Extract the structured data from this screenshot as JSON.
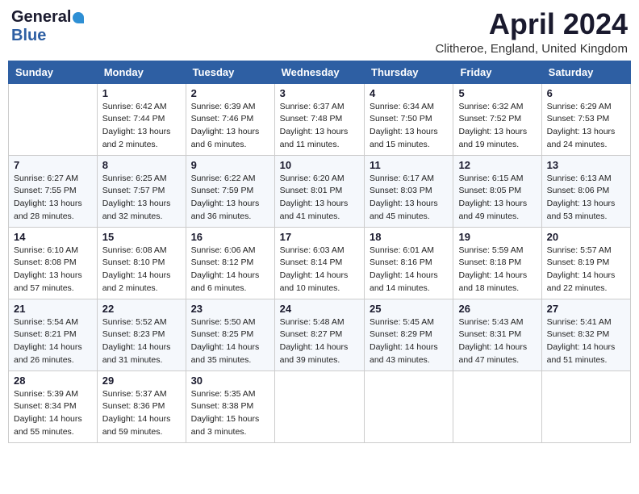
{
  "logo": {
    "general": "General",
    "blue": "Blue"
  },
  "title": "April 2024",
  "location": "Clitheroe, England, United Kingdom",
  "days_of_week": [
    "Sunday",
    "Monday",
    "Tuesday",
    "Wednesday",
    "Thursday",
    "Friday",
    "Saturday"
  ],
  "weeks": [
    [
      {
        "day": "",
        "sunrise": "",
        "sunset": "",
        "daylight": ""
      },
      {
        "day": "1",
        "sunrise": "Sunrise: 6:42 AM",
        "sunset": "Sunset: 7:44 PM",
        "daylight": "Daylight: 13 hours and 2 minutes."
      },
      {
        "day": "2",
        "sunrise": "Sunrise: 6:39 AM",
        "sunset": "Sunset: 7:46 PM",
        "daylight": "Daylight: 13 hours and 6 minutes."
      },
      {
        "day": "3",
        "sunrise": "Sunrise: 6:37 AM",
        "sunset": "Sunset: 7:48 PM",
        "daylight": "Daylight: 13 hours and 11 minutes."
      },
      {
        "day": "4",
        "sunrise": "Sunrise: 6:34 AM",
        "sunset": "Sunset: 7:50 PM",
        "daylight": "Daylight: 13 hours and 15 minutes."
      },
      {
        "day": "5",
        "sunrise": "Sunrise: 6:32 AM",
        "sunset": "Sunset: 7:52 PM",
        "daylight": "Daylight: 13 hours and 19 minutes."
      },
      {
        "day": "6",
        "sunrise": "Sunrise: 6:29 AM",
        "sunset": "Sunset: 7:53 PM",
        "daylight": "Daylight: 13 hours and 24 minutes."
      }
    ],
    [
      {
        "day": "7",
        "sunrise": "Sunrise: 6:27 AM",
        "sunset": "Sunset: 7:55 PM",
        "daylight": "Daylight: 13 hours and 28 minutes."
      },
      {
        "day": "8",
        "sunrise": "Sunrise: 6:25 AM",
        "sunset": "Sunset: 7:57 PM",
        "daylight": "Daylight: 13 hours and 32 minutes."
      },
      {
        "day": "9",
        "sunrise": "Sunrise: 6:22 AM",
        "sunset": "Sunset: 7:59 PM",
        "daylight": "Daylight: 13 hours and 36 minutes."
      },
      {
        "day": "10",
        "sunrise": "Sunrise: 6:20 AM",
        "sunset": "Sunset: 8:01 PM",
        "daylight": "Daylight: 13 hours and 41 minutes."
      },
      {
        "day": "11",
        "sunrise": "Sunrise: 6:17 AM",
        "sunset": "Sunset: 8:03 PM",
        "daylight": "Daylight: 13 hours and 45 minutes."
      },
      {
        "day": "12",
        "sunrise": "Sunrise: 6:15 AM",
        "sunset": "Sunset: 8:05 PM",
        "daylight": "Daylight: 13 hours and 49 minutes."
      },
      {
        "day": "13",
        "sunrise": "Sunrise: 6:13 AM",
        "sunset": "Sunset: 8:06 PM",
        "daylight": "Daylight: 13 hours and 53 minutes."
      }
    ],
    [
      {
        "day": "14",
        "sunrise": "Sunrise: 6:10 AM",
        "sunset": "Sunset: 8:08 PM",
        "daylight": "Daylight: 13 hours and 57 minutes."
      },
      {
        "day": "15",
        "sunrise": "Sunrise: 6:08 AM",
        "sunset": "Sunset: 8:10 PM",
        "daylight": "Daylight: 14 hours and 2 minutes."
      },
      {
        "day": "16",
        "sunrise": "Sunrise: 6:06 AM",
        "sunset": "Sunset: 8:12 PM",
        "daylight": "Daylight: 14 hours and 6 minutes."
      },
      {
        "day": "17",
        "sunrise": "Sunrise: 6:03 AM",
        "sunset": "Sunset: 8:14 PM",
        "daylight": "Daylight: 14 hours and 10 minutes."
      },
      {
        "day": "18",
        "sunrise": "Sunrise: 6:01 AM",
        "sunset": "Sunset: 8:16 PM",
        "daylight": "Daylight: 14 hours and 14 minutes."
      },
      {
        "day": "19",
        "sunrise": "Sunrise: 5:59 AM",
        "sunset": "Sunset: 8:18 PM",
        "daylight": "Daylight: 14 hours and 18 minutes."
      },
      {
        "day": "20",
        "sunrise": "Sunrise: 5:57 AM",
        "sunset": "Sunset: 8:19 PM",
        "daylight": "Daylight: 14 hours and 22 minutes."
      }
    ],
    [
      {
        "day": "21",
        "sunrise": "Sunrise: 5:54 AM",
        "sunset": "Sunset: 8:21 PM",
        "daylight": "Daylight: 14 hours and 26 minutes."
      },
      {
        "day": "22",
        "sunrise": "Sunrise: 5:52 AM",
        "sunset": "Sunset: 8:23 PM",
        "daylight": "Daylight: 14 hours and 31 minutes."
      },
      {
        "day": "23",
        "sunrise": "Sunrise: 5:50 AM",
        "sunset": "Sunset: 8:25 PM",
        "daylight": "Daylight: 14 hours and 35 minutes."
      },
      {
        "day": "24",
        "sunrise": "Sunrise: 5:48 AM",
        "sunset": "Sunset: 8:27 PM",
        "daylight": "Daylight: 14 hours and 39 minutes."
      },
      {
        "day": "25",
        "sunrise": "Sunrise: 5:45 AM",
        "sunset": "Sunset: 8:29 PM",
        "daylight": "Daylight: 14 hours and 43 minutes."
      },
      {
        "day": "26",
        "sunrise": "Sunrise: 5:43 AM",
        "sunset": "Sunset: 8:31 PM",
        "daylight": "Daylight: 14 hours and 47 minutes."
      },
      {
        "day": "27",
        "sunrise": "Sunrise: 5:41 AM",
        "sunset": "Sunset: 8:32 PM",
        "daylight": "Daylight: 14 hours and 51 minutes."
      }
    ],
    [
      {
        "day": "28",
        "sunrise": "Sunrise: 5:39 AM",
        "sunset": "Sunset: 8:34 PM",
        "daylight": "Daylight: 14 hours and 55 minutes."
      },
      {
        "day": "29",
        "sunrise": "Sunrise: 5:37 AM",
        "sunset": "Sunset: 8:36 PM",
        "daylight": "Daylight: 14 hours and 59 minutes."
      },
      {
        "day": "30",
        "sunrise": "Sunrise: 5:35 AM",
        "sunset": "Sunset: 8:38 PM",
        "daylight": "Daylight: 15 hours and 3 minutes."
      },
      {
        "day": "",
        "sunrise": "",
        "sunset": "",
        "daylight": ""
      },
      {
        "day": "",
        "sunrise": "",
        "sunset": "",
        "daylight": ""
      },
      {
        "day": "",
        "sunrise": "",
        "sunset": "",
        "daylight": ""
      },
      {
        "day": "",
        "sunrise": "",
        "sunset": "",
        "daylight": ""
      }
    ]
  ]
}
